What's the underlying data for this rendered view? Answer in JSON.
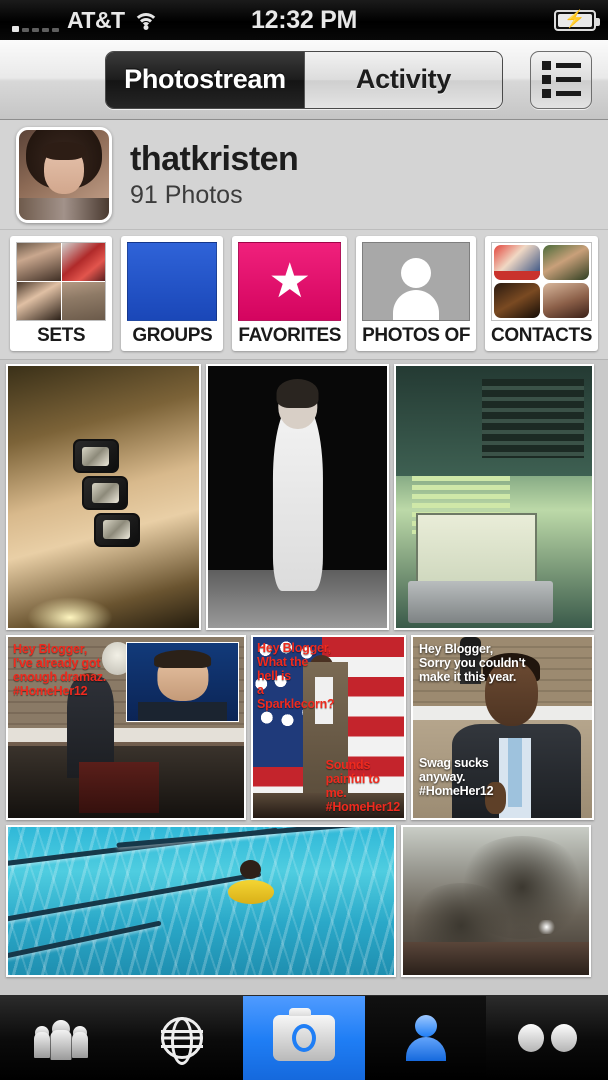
{
  "status_bar": {
    "carrier": "AT&T",
    "time": "12:32 PM",
    "signal_icon": "signal-bars-icon",
    "wifi_icon": "wifi-icon",
    "battery_icon": "battery-charging-icon",
    "signal_bars_filled": 1,
    "signal_bars_total": 5
  },
  "nav": {
    "tabs": [
      {
        "label": "Photostream",
        "selected": true
      },
      {
        "label": "Activity",
        "selected": false
      }
    ],
    "list_view_button_icon": "list-view-icon"
  },
  "profile": {
    "username": "thatkristen",
    "photo_count": "91 Photos",
    "avatar_icon": "avatar"
  },
  "categories": [
    {
      "label": "SETS",
      "type": "collage",
      "icon": "sets-collage-icon"
    },
    {
      "label": "GROUPS",
      "type": "solid",
      "color": "#1a47b8",
      "icon": "people-icon"
    },
    {
      "label": "FAVORITES",
      "type": "solid",
      "color": "#e8176e",
      "icon": "star-icon"
    },
    {
      "label": "PHOTOS OF",
      "type": "solid",
      "color": "#a8a8a8",
      "icon": "person-icon"
    },
    {
      "label": "CONTACTS",
      "type": "collage",
      "icon": "contacts-collage-icon"
    }
  ],
  "photo_grid": {
    "rows": [
      {
        "photos": [
          {
            "alt": "hand-with-three-rings",
            "captions": []
          },
          {
            "alt": "black-and-white-girl-in-leotard",
            "captions": []
          },
          {
            "alt": "laptop-on-cafe-table",
            "captions": []
          }
        ]
      },
      {
        "photos": [
          {
            "alt": "obama-at-podium-with-romney-inset",
            "captions": [
              {
                "text": "Hey Blogger,\nI've already got\nenough dramaz.\n#HomeHer12",
                "color": "red",
                "position": "top-left"
              }
            ]
          },
          {
            "alt": "obama-speaking-in-front-of-flag",
            "captions": [
              {
                "text": "Hey Blogger,\nWhat the\nhell is\na\nSparklecorn?",
                "color": "red",
                "position": "top-left"
              },
              {
                "text": "Sounds\npainful to\nme.\n#HomeHer12",
                "color": "red",
                "position": "bottom-right"
              }
            ]
          },
          {
            "alt": "obama-thumbs-up",
            "captions": [
              {
                "text": "Hey Blogger,\nSorry you couldn't\nmake it this year.",
                "color": "white",
                "position": "top-left"
              },
              {
                "text": "Swag sucks\nanyway.\n#HomeHer12",
                "color": "white",
                "position": "bottom-left"
              }
            ]
          }
        ]
      },
      {
        "photos": [
          {
            "alt": "child-in-yellow-float-in-swimming-pool",
            "captions": []
          },
          {
            "alt": "dark-storm-clouds",
            "captions": []
          }
        ]
      }
    ]
  },
  "tab_bar": {
    "items": [
      {
        "icon": "contacts-group-icon",
        "selected": false
      },
      {
        "icon": "globe-explore-icon",
        "selected": false
      },
      {
        "icon": "camera-icon",
        "selected": true
      },
      {
        "icon": "person-profile-icon",
        "selected": false
      },
      {
        "icon": "flickr-dots-icon",
        "selected": false
      }
    ]
  }
}
